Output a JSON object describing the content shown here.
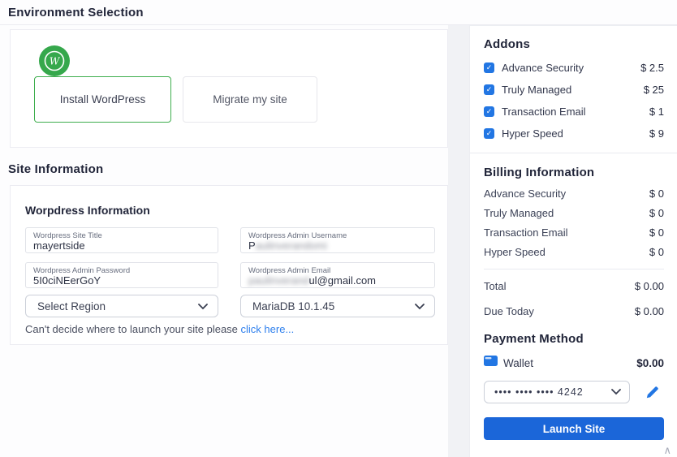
{
  "header": {
    "title": "Environment Selection"
  },
  "environment": {
    "options": [
      {
        "label": "Install WordPress",
        "selected": true
      },
      {
        "label": "Migrate my site",
        "selected": false
      }
    ],
    "badge_icon": "wordpress-icon",
    "selected_border_color": "#3fae4e",
    "badge_color": "#36a84c"
  },
  "site_information": {
    "section_title": "Site Information",
    "panel_title": "Worpdress Information",
    "fields": {
      "site_title": {
        "label": "Wordpress Site Title",
        "value": "mayertside"
      },
      "admin_username": {
        "label": "Wordpress Admin Username",
        "visible_prefix": "P",
        "blurred_text": "aulinverandomi"
      },
      "admin_password": {
        "label": "Wordpress Admin Password",
        "value": "5I0ciNEerGoY"
      },
      "admin_email": {
        "label": "Wordpress Admin Email",
        "blurred_text": "paulinverand",
        "visible_suffix": "ul@gmail.com"
      }
    },
    "region_select": {
      "value": "Select Region"
    },
    "database_select": {
      "value": "MariaDB 10.1.45"
    },
    "helper_text": "Can't decide where to launch your site please ",
    "helper_link": "click here..."
  },
  "addons": {
    "title": "Addons",
    "checkbox_color": "#2276e3",
    "items": [
      {
        "label": "Advance Security",
        "price": "$ 2.5",
        "checked": true
      },
      {
        "label": "Truly Managed",
        "price": "$ 25",
        "checked": true
      },
      {
        "label": "Transaction Email",
        "price": "$ 1",
        "checked": true
      },
      {
        "label": "Hyper Speed",
        "price": "$ 9",
        "checked": true
      }
    ]
  },
  "billing": {
    "title": "Billing Information",
    "items": [
      {
        "label": "Advance Security",
        "price": "$ 0"
      },
      {
        "label": "Truly Managed",
        "price": "$ 0"
      },
      {
        "label": "Transaction Email",
        "price": "$ 0"
      },
      {
        "label": "Hyper Speed",
        "price": "$ 0"
      }
    ],
    "total_label": "Total",
    "total_value": "$ 0.00",
    "due_label": "Due Today",
    "due_value": "$ 0.00"
  },
  "payment": {
    "title": "Payment Method",
    "wallet_icon": "wallet-icon",
    "wallet_label": "Wallet",
    "wallet_amount": "$0.00",
    "card_value": "•••• •••• •••• 4242",
    "edit_icon": "pencil-icon",
    "launch_button": "Launch Site",
    "button_color": "#1b66d9"
  },
  "misc": {
    "scroll_caret": "∧"
  }
}
